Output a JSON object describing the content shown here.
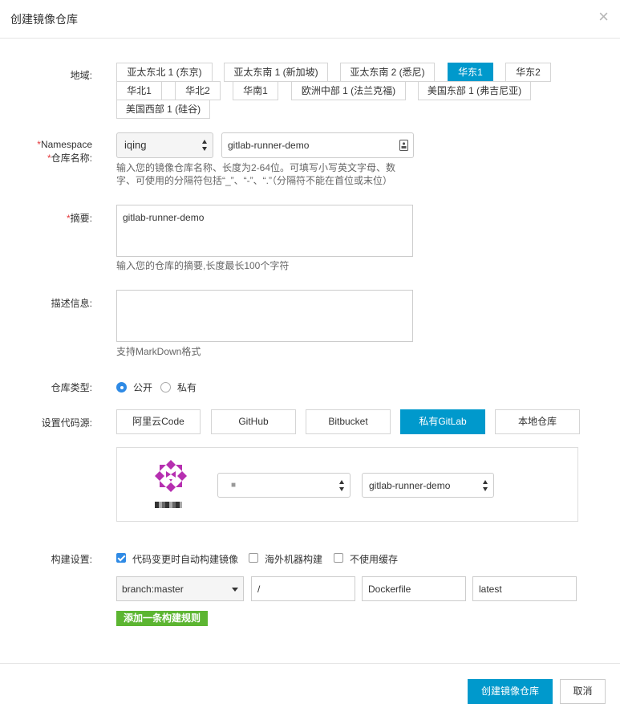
{
  "dialog": {
    "title": "创建镜像仓库",
    "close": "×"
  },
  "region": {
    "label": "地域:",
    "options": [
      "亚太东北 1 (东京)",
      "亚太东南 1 (新加坡)",
      "亚太东南 2 (悉尼)",
      "华东1",
      "华东2",
      "华北1",
      "华北2",
      "华南1",
      "欧洲中部 1 (法兰克福)",
      "美国东部 1 (弗吉尼亚)",
      "美国西部 1 (硅谷)"
    ],
    "selected": "华东1"
  },
  "namespace": {
    "label": "Namespace",
    "required_mark": "*",
    "value": "iqing"
  },
  "repo_name": {
    "label": "仓库名称:",
    "required_mark": "*",
    "value": "gitlab-runner-demo",
    "hint_line1": "输入您的镜像仓库名称、长度为2-64位。可填写小写英文字母、数",
    "hint_line2": "字、可使用的分隔符包括“_”、“-”、“.”（分隔符不能在首位或末位）"
  },
  "summary": {
    "label": "摘要:",
    "required_mark": "*",
    "value": "gitlab-runner-demo",
    "hint": "输入您的仓库的摘要,长度最长100个字符"
  },
  "description": {
    "label": "描述信息:",
    "value": "",
    "hint": "支持MarkDown格式"
  },
  "repo_type": {
    "label": "仓库类型:",
    "options": [
      "公开",
      "私有"
    ],
    "selected": "公开"
  },
  "code_source": {
    "label": "设置代码源:",
    "options": [
      "阿里云Code",
      "GitHub",
      "Bitbucket",
      "私有GitLab",
      "本地仓库"
    ],
    "selected": "私有GitLab",
    "owner_select": "■",
    "project_select": "gitlab-runner-demo"
  },
  "build": {
    "label": "构建设置:",
    "options": [
      {
        "label": "代码变更时自动构建镜像",
        "checked": true
      },
      {
        "label": "海外机器构建",
        "checked": false
      },
      {
        "label": "不使用缓存",
        "checked": false
      }
    ],
    "rule": {
      "branch": "branch:master",
      "dir": "/",
      "dockerfile": "Dockerfile",
      "tag": "latest"
    },
    "add_rule": "添加一条构建规则"
  },
  "footer": {
    "create": "创建镜像仓库",
    "cancel": "取消"
  },
  "colors": {
    "accent": "#0099cc",
    "green": "#5cb531",
    "required": "#e4393c",
    "avatar": "#b62fb0"
  },
  "icons": [
    "close-icon",
    "select-arrows-icon",
    "contact-card-icon",
    "gitlab-avatar-icon",
    "dropdown-caret-icon",
    "check-icon"
  ]
}
